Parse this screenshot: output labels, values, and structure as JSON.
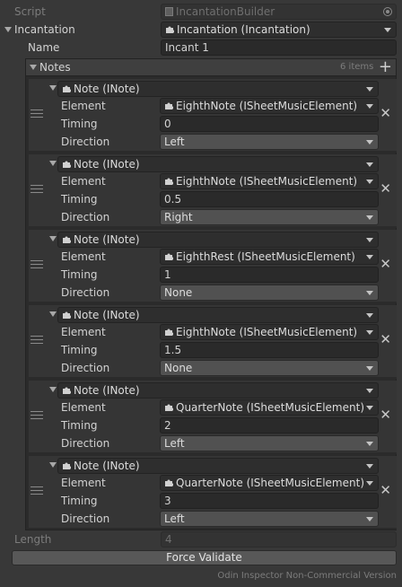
{
  "inspector": {
    "script_label": "Script",
    "script_value": "IncantationBuilder",
    "incantation_label": "Incantation",
    "incantation_value": "Incantation (Incantation)",
    "name_label": "Name",
    "name_value": "Incant 1",
    "notes_label": "Notes",
    "notes_count": "6 items",
    "length_label": "Length",
    "length_value": "4",
    "force_validate_label": "Force Validate",
    "footer": "Odin Inspector Non-Commercial Version"
  },
  "notes": [
    {
      "type": "Note (INote)",
      "element_label": "Element",
      "element": "EighthNote (ISheetMusicElement)",
      "timing_label": "Timing",
      "timing": "0",
      "direction_label": "Direction",
      "direction": "Left"
    },
    {
      "type": "Note (INote)",
      "element_label": "Element",
      "element": "EighthNote (ISheetMusicElement)",
      "timing_label": "Timing",
      "timing": "0.5",
      "direction_label": "Direction",
      "direction": "Right"
    },
    {
      "type": "Note (INote)",
      "element_label": "Element",
      "element": "EighthRest (ISheetMusicElement)",
      "timing_label": "Timing",
      "timing": "1",
      "direction_label": "Direction",
      "direction": "None"
    },
    {
      "type": "Note (INote)",
      "element_label": "Element",
      "element": "EighthNote (ISheetMusicElement)",
      "timing_label": "Timing",
      "timing": "1.5",
      "direction_label": "Direction",
      "direction": "None"
    },
    {
      "type": "Note (INote)",
      "element_label": "Element",
      "element": "QuarterNote (ISheetMusicElement)",
      "timing_label": "Timing",
      "timing": "2",
      "direction_label": "Direction",
      "direction": "Left"
    },
    {
      "type": "Note (INote)",
      "element_label": "Element",
      "element": "QuarterNote (ISheetMusicElement)",
      "timing_label": "Timing",
      "timing": "3",
      "direction_label": "Direction",
      "direction": "Left"
    }
  ],
  "icons": {
    "script": "script-file-icon",
    "target": "object-picker-icon",
    "puzzle": "puzzle-piece-icon",
    "add": "plus-icon",
    "remove": "close-icon",
    "drag": "drag-handle-icon"
  }
}
